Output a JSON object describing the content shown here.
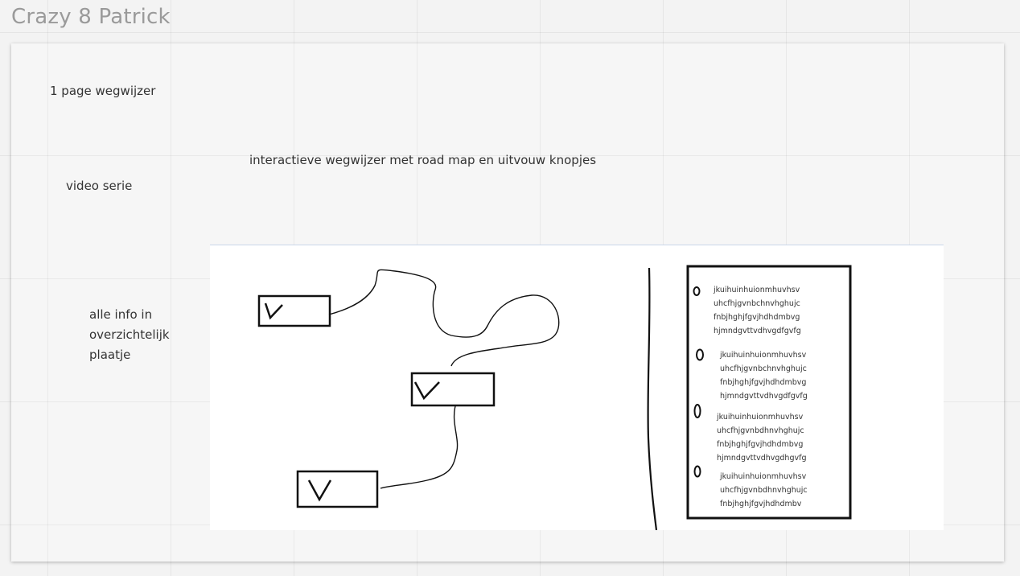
{
  "board": {
    "frame_title": "Crazy 8 Patrick"
  },
  "notes": {
    "one_page": "1 page wegwijzer",
    "interactive": "interactieve wegwijzer met road map en uitvouw knopjes",
    "video": "video serie",
    "overview": "alle info in overzichtelijk plaatje"
  },
  "sketch": {
    "box_mark": "V",
    "bullet_mark": "0",
    "scribble_lines": [
      [
        "jkuihuinhuionmhuvhsv",
        "uhcfhjgvnbchnvhghujc",
        "fnbjhghjfgvjhdhdmbvg",
        "hjmndgvttvdhvgdfgvfg"
      ],
      [
        "jkuihuinhuionmhuvhsv",
        "uhcfhjgvnbchnvhghujc",
        "fnbjhghjfgvjhdhdmbvg",
        "hjmndgvttvdhvgdfgvfg"
      ],
      [
        "jkuihuinhuionmhuvhsv",
        "uhcfhjgvnbdhnvhghujc",
        "fnbjhghjfgvjhdhdmbvg",
        "hjmndgvttvdhvgdhgvfg"
      ],
      [
        "jkuihuinhuionmhuvhsv",
        "uhcfhjgvnbdhnvhghujc",
        "fnbjhghjfgvjhdhdmbv"
      ]
    ]
  },
  "colors": {
    "ink": "#111111",
    "note_text": "#333333",
    "title_text": "#9a9a9a"
  }
}
